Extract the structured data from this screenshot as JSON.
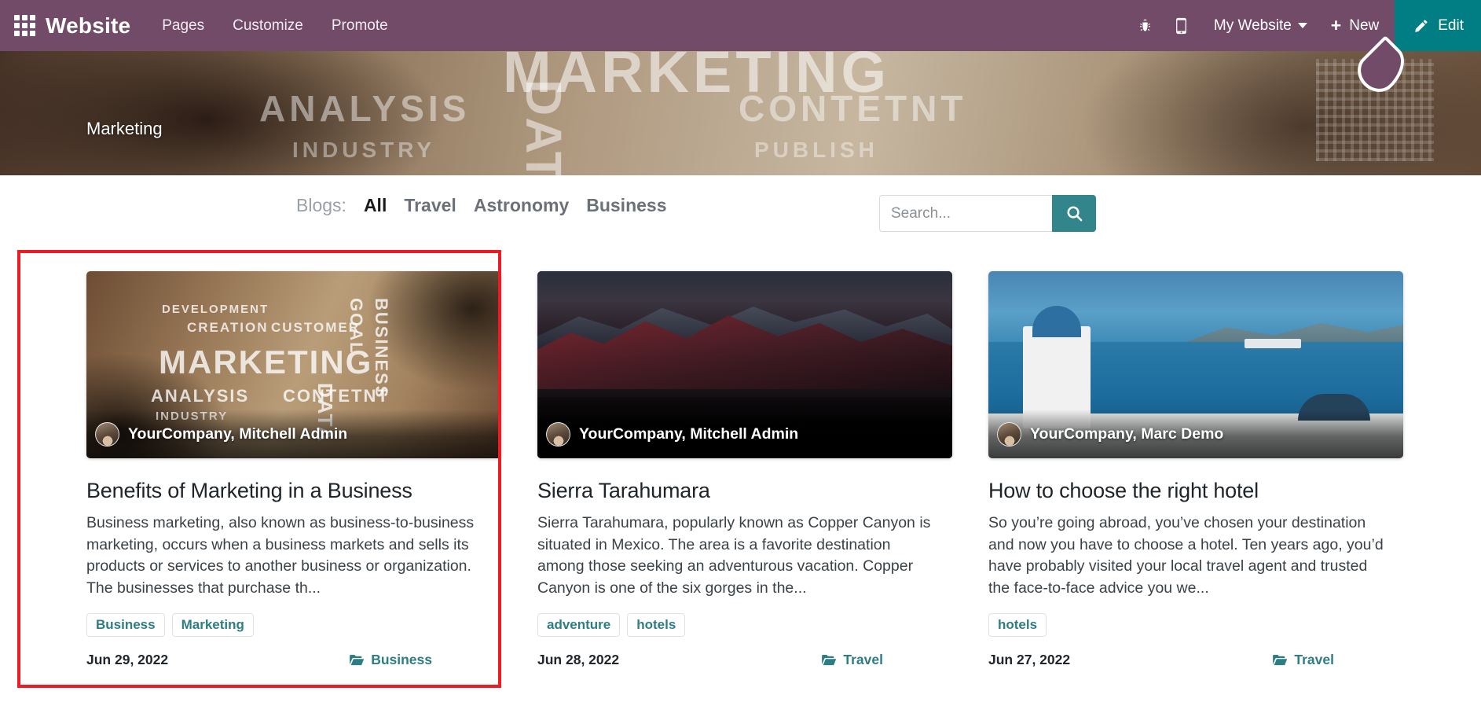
{
  "navbar": {
    "apps_icon": "apps-grid-icon",
    "brand": "Website",
    "links": [
      {
        "label": "Pages"
      },
      {
        "label": "Customize"
      },
      {
        "label": "Promote"
      }
    ],
    "bug_icon": "bug-icon",
    "mobile_icon": "mobile-preview-icon",
    "website_selector": "My Website",
    "new_label": "New",
    "new_icon": "plus-icon",
    "edit_label": "Edit",
    "edit_icon": "pencil-icon",
    "bg_color": "#714B67",
    "edit_bg_color": "#017E84"
  },
  "hero": {
    "breadcrumb": "Marketing",
    "banner_words": {
      "w1": "MARKETING",
      "w2": "ANALYSIS",
      "w3": "CONTETNT",
      "w4": "INDUSTRY",
      "w5": "PUBLISH",
      "w6": "DATA"
    },
    "drop_icon": "water-drop-icon"
  },
  "filterbar": {
    "label": "Blogs:",
    "items": [
      {
        "label": "All",
        "active": true
      },
      {
        "label": "Travel",
        "active": false
      },
      {
        "label": "Astronomy",
        "active": false
      },
      {
        "label": "Business",
        "active": false
      }
    ]
  },
  "search": {
    "value": "",
    "placeholder": "Search...",
    "button_icon": "search-icon",
    "button_color": "#31858B"
  },
  "cards": [
    {
      "author": "YourCompany, Mitchell Admin",
      "title": "Benefits of Marketing in a Business",
      "excerpt": "Business marketing, also known as business-to-business marketing, occurs when a business markets and sells its products or services to another business or organization. The businesses that purchase th...",
      "tags": [
        "Business",
        "Marketing"
      ],
      "date": "Jun 29, 2022",
      "category": "Business",
      "category_icon": "folder-open-icon",
      "highlighted": true
    },
    {
      "author": "YourCompany, Mitchell Admin",
      "title": "Sierra Tarahumara",
      "excerpt": "Sierra Tarahumara, popularly known as Copper Canyon is situated in Mexico. The area is a favorite destination among those seeking an adventurous vacation. Copper Canyon is one of the six gorges in the...",
      "tags": [
        "adventure",
        "hotels"
      ],
      "date": "Jun 28, 2022",
      "category": "Travel",
      "category_icon": "folder-open-icon",
      "highlighted": false
    },
    {
      "author": "YourCompany, Marc Demo",
      "title": "How to choose the right hotel",
      "excerpt": "So you’re going abroad, you’ve chosen your destination and now you have to choose a hotel. Ten years ago, you’d have probably visited your local travel agent and trusted the face-to-face advice you we...",
      "tags": [
        "hotels"
      ],
      "date": "Jun 27, 2022",
      "category": "Travel",
      "category_icon": "folder-open-icon",
      "highlighted": false
    }
  ],
  "highlight": {
    "color": "#ED1C24",
    "target": "first-blog-card"
  }
}
